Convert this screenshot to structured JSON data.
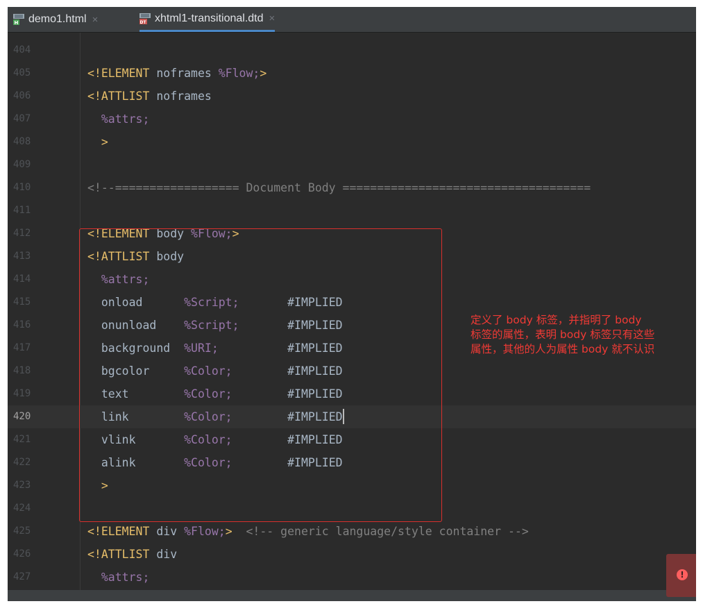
{
  "tabs": [
    {
      "label": "demo1.html",
      "icon": "html-file-icon",
      "active": false
    },
    {
      "label": "xhtml1-transitional.dtd",
      "icon": "dtd-file-icon",
      "active": true
    }
  ],
  "tab_close_glyph": "×",
  "colors": {
    "keyword": "#e8bf6a",
    "entity": "#9876aa",
    "comment": "#808080",
    "annotation": "#f03a35"
  },
  "current_line": "420",
  "lines": [
    {
      "n": "404",
      "parts": []
    },
    {
      "n": "405",
      "parts": [
        [
          "kw",
          "<!ELEMENT"
        ],
        [
          "pl",
          " noframes "
        ],
        [
          "ent",
          "%Flow;"
        ],
        [
          "kw",
          ">"
        ]
      ]
    },
    {
      "n": "406",
      "parts": [
        [
          "kw",
          "<!ATTLIST"
        ],
        [
          "pl",
          " noframes"
        ]
      ]
    },
    {
      "n": "407",
      "parts": [
        [
          "pl",
          "  "
        ],
        [
          "ent",
          "%attrs;"
        ]
      ]
    },
    {
      "n": "408",
      "parts": [
        [
          "pl",
          "  "
        ],
        [
          "kw",
          ">"
        ]
      ]
    },
    {
      "n": "409",
      "parts": []
    },
    {
      "n": "410",
      "parts": [
        [
          "cm",
          "<!--================== Document Body ===================================="
        ]
      ]
    },
    {
      "n": "411",
      "parts": []
    },
    {
      "n": "412",
      "parts": [
        [
          "kw",
          "<!ELEMENT"
        ],
        [
          "pl",
          " body "
        ],
        [
          "ent",
          "%Flow;"
        ],
        [
          "kw",
          ">"
        ]
      ]
    },
    {
      "n": "413",
      "parts": [
        [
          "kw",
          "<!ATTLIST"
        ],
        [
          "pl",
          " body"
        ]
      ]
    },
    {
      "n": "414",
      "parts": [
        [
          "pl",
          "  "
        ],
        [
          "ent",
          "%attrs;"
        ]
      ]
    },
    {
      "n": "415",
      "parts": [
        [
          "pl",
          "  onload      "
        ],
        [
          "ent",
          "%Script;"
        ],
        [
          "pl",
          "       #IMPLIED"
        ]
      ]
    },
    {
      "n": "416",
      "parts": [
        [
          "pl",
          "  onunload    "
        ],
        [
          "ent",
          "%Script;"
        ],
        [
          "pl",
          "       #IMPLIED"
        ]
      ]
    },
    {
      "n": "417",
      "parts": [
        [
          "pl",
          "  background  "
        ],
        [
          "ent",
          "%URI;"
        ],
        [
          "pl",
          "          #IMPLIED"
        ]
      ]
    },
    {
      "n": "418",
      "parts": [
        [
          "pl",
          "  bgcolor     "
        ],
        [
          "ent",
          "%Color;"
        ],
        [
          "pl",
          "        #IMPLIED"
        ]
      ]
    },
    {
      "n": "419",
      "parts": [
        [
          "pl",
          "  text        "
        ],
        [
          "ent",
          "%Color;"
        ],
        [
          "pl",
          "        #IMPLIED"
        ]
      ]
    },
    {
      "n": "420",
      "parts": [
        [
          "pl",
          "  link        "
        ],
        [
          "ent",
          "%Color;"
        ],
        [
          "pl",
          "        #IMPLIED"
        ]
      ]
    },
    {
      "n": "421",
      "parts": [
        [
          "pl",
          "  vlink       "
        ],
        [
          "ent",
          "%Color;"
        ],
        [
          "pl",
          "        #IMPLIED"
        ]
      ]
    },
    {
      "n": "422",
      "parts": [
        [
          "pl",
          "  alink       "
        ],
        [
          "ent",
          "%Color;"
        ],
        [
          "pl",
          "        #IMPLIED"
        ]
      ]
    },
    {
      "n": "423",
      "parts": [
        [
          "pl",
          "  "
        ],
        [
          "kw",
          ">"
        ]
      ]
    },
    {
      "n": "424",
      "parts": []
    },
    {
      "n": "425",
      "parts": [
        [
          "kw",
          "<!ELEMENT"
        ],
        [
          "pl",
          " div "
        ],
        [
          "ent",
          "%Flow;"
        ],
        [
          "kw",
          ">"
        ],
        [
          "cm",
          "  <!-- generic language/style container -->"
        ]
      ]
    },
    {
      "n": "426",
      "parts": [
        [
          "kw",
          "<!ATTLIST"
        ],
        [
          "pl",
          " div"
        ]
      ]
    },
    {
      "n": "427",
      "parts": [
        [
          "pl",
          "  "
        ],
        [
          "ent",
          "%attrs;"
        ]
      ]
    }
  ],
  "annotation": {
    "lines": [
      "定义了 body 标签，并指明了 body",
      "标签的属性，表明 body 标签只有这些",
      "属性，其他的人为属性 body 就不认识"
    ]
  },
  "error_indicator": {
    "icon": "error-icon",
    "glyph": "!"
  }
}
